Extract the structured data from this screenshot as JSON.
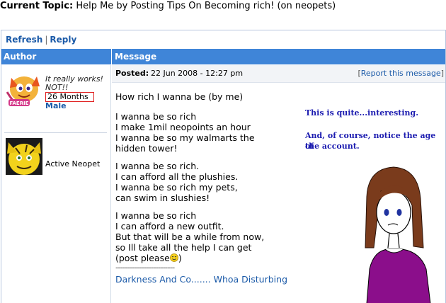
{
  "topic": {
    "label": "Current Topic:",
    "title": "Help Me by Posting Tips On Becoming rich! (on neopets)"
  },
  "toolbar": {
    "refresh": "Refresh",
    "sep": "|",
    "reply": "Reply"
  },
  "headers": {
    "author": "Author",
    "message": "Message"
  },
  "post": {
    "posted_label": "Posted:",
    "date": "22 Jun 2008 - 12:27 pm",
    "report_open": "[",
    "report": "Report this message",
    "report_close": "]"
  },
  "author": {
    "quote1": "It really works!",
    "quote2": "NOT!!",
    "months": "26 Months",
    "gender": "Male",
    "badge": "FAERIE",
    "pet_status": "Active Neopet"
  },
  "message": {
    "title": "How rich I wanna be (by me)",
    "stanza1": "I wanna be so rich\nI make 1mil neopoints an hour\nI wanna be so my walmarts the\nhidden tower!",
    "stanza2": "I wanna be so rich.\nI can afford all the plushies.\nI wanna be so rich my pets,\ncan swim in slushies!",
    "stanza3": "I wanna be so rich\nI can afford a new outfit.\nBut that will be a while from now,\nso Ill take all the help I can get",
    "last_line": "(post please",
    "last_close": ")",
    "sig_line": "-------------------------",
    "sig_link": "Darkness And Co....... Whoa Disturbing"
  },
  "annotation": {
    "line1": "This is quite...interesting.",
    "line2": "And, of course, notice the age of",
    "line3": "the account."
  },
  "colors": {
    "header": "#3f85d8",
    "link": "#1b5aa8",
    "note": "#1c1cb0",
    "highlight": "#e02020",
    "shirt": "#8b0e8b",
    "hair": "#7a3b1c"
  }
}
